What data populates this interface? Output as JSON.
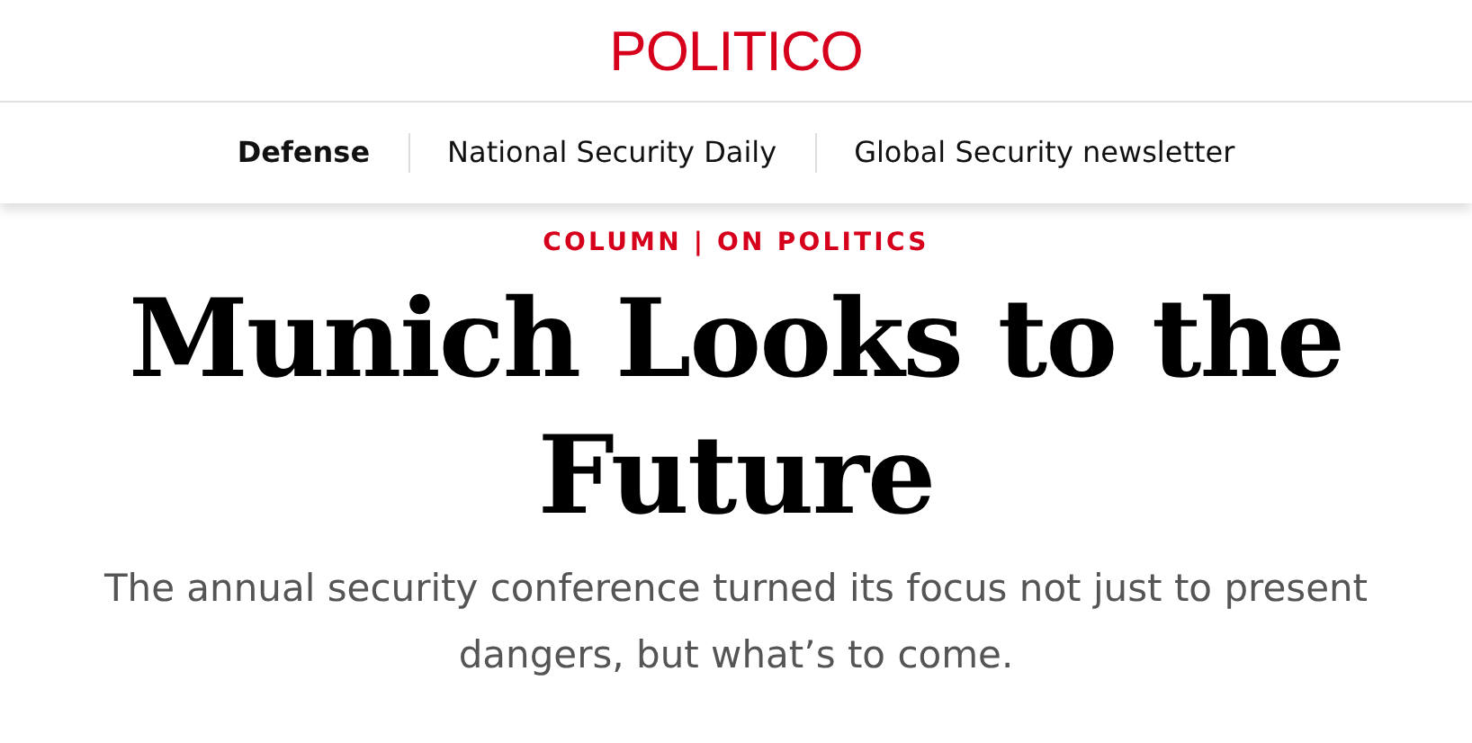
{
  "logo": "POLITICO",
  "nav": [
    {
      "label": "Defense",
      "selected": true
    },
    {
      "label": "National Security Daily",
      "selected": false
    },
    {
      "label": "Global Security newsletter",
      "selected": false
    }
  ],
  "kicker": "COLUMN | ON POLITICS",
  "headline": "Munich Looks to the Future",
  "subtitle": "The annual security conference turned its focus not just to present dangers, but what’s to come."
}
